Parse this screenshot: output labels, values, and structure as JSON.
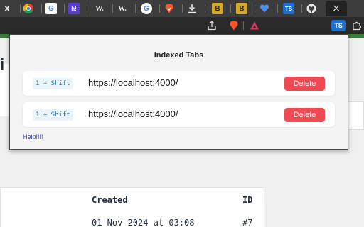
{
  "browser": {
    "tabs": [
      {
        "icon": "x-icon",
        "label": "X"
      },
      {
        "icon": "chrome-icon"
      },
      {
        "icon": "google-icon",
        "label": "G"
      },
      {
        "icon": "hashnode-icon",
        "label": "h!"
      },
      {
        "icon": "wikipedia-icon",
        "label": "W."
      },
      {
        "icon": "wikipedia-icon",
        "label": "W."
      },
      {
        "icon": "google-icon",
        "label": "G"
      },
      {
        "icon": "brave-icon"
      },
      {
        "icon": "download-icon"
      },
      {
        "icon": "bookmark-b-icon",
        "label": "B"
      },
      {
        "icon": "bookmark-b-icon",
        "label": "B"
      },
      {
        "icon": "heart-icon"
      },
      {
        "icon": "typescript-icon",
        "label": "TS"
      },
      {
        "icon": "github-icon"
      }
    ],
    "close_tab": "×",
    "extension_badge": "TS",
    "colors": {
      "tabstrip": "#3c3c3c",
      "toolbar": "#2a2a2a",
      "accent_green": "#3a7c3a"
    }
  },
  "popup": {
    "title": "Indexed Tabs",
    "entries": [
      {
        "shortcut": "1 + Shift",
        "url": "https://localhost:4000/",
        "delete_label": "Delete"
      },
      {
        "shortcut": "1 + Shift",
        "url": "https://localhost:4000/",
        "delete_label": "Delete"
      }
    ],
    "help_link": "Help!!!!",
    "colors": {
      "delete": "#ef4a53",
      "shortcut_bg": "#e9f4fb",
      "shortcut_text": "#2a7bb3"
    }
  },
  "page": {
    "heading_fragment": "i",
    "table": {
      "headers": {
        "created": "Created",
        "id": "ID"
      },
      "row": {
        "created": "01 Nov 2024 at 03:08",
        "id": "#7"
      }
    }
  }
}
